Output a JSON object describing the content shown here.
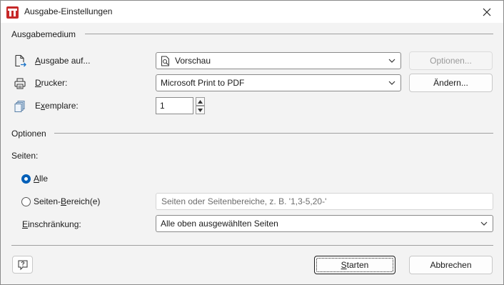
{
  "window": {
    "title": "Ausgabe-Einstellungen"
  },
  "ausgabemedium": {
    "section_label": "Ausgabemedium",
    "ausgabe_auf": {
      "label_prefix": "",
      "label_mnemonic": "A",
      "label_rest": "usgabe auf...",
      "value": "Vorschau",
      "button_label": "Optionen..."
    },
    "drucker": {
      "label_mnemonic": "D",
      "label_rest": "rucker:",
      "value": "Microsoft Print to PDF",
      "button_label": "Ändern..."
    },
    "exemplare": {
      "label_prefix": "E",
      "label_mnemonic": "x",
      "label_rest": "emplare:",
      "value": "1"
    }
  },
  "optionen": {
    "section_label": "Optionen",
    "seiten_label": "Seiten:",
    "alle": {
      "label_mnemonic": "A",
      "label_rest": "lle",
      "checked": true
    },
    "bereich": {
      "label_prefix": "Seiten-",
      "label_mnemonic": "B",
      "label_rest": "ereich(e)",
      "placeholder": "Seiten oder Seitenbereiche, z. B. '1,3-5,20-'",
      "checked": false
    },
    "einschraenkung": {
      "label_mnemonic": "E",
      "label_rest": "inschränkung:",
      "value": "Alle oben ausgewählten Seiten"
    }
  },
  "footer": {
    "start_label_mnemonic": "S",
    "start_label_rest": "tarten",
    "cancel_label": "Abbrechen"
  },
  "icons": {
    "app": "app-logo-icon",
    "close": "close-icon",
    "output": "output-page-icon",
    "printer": "printer-icon",
    "copies": "copies-icon",
    "preview": "preview-page-icon",
    "help": "help-question-icon"
  },
  "colors": {
    "accent": "#005fb8",
    "app_red": "#c62828"
  }
}
